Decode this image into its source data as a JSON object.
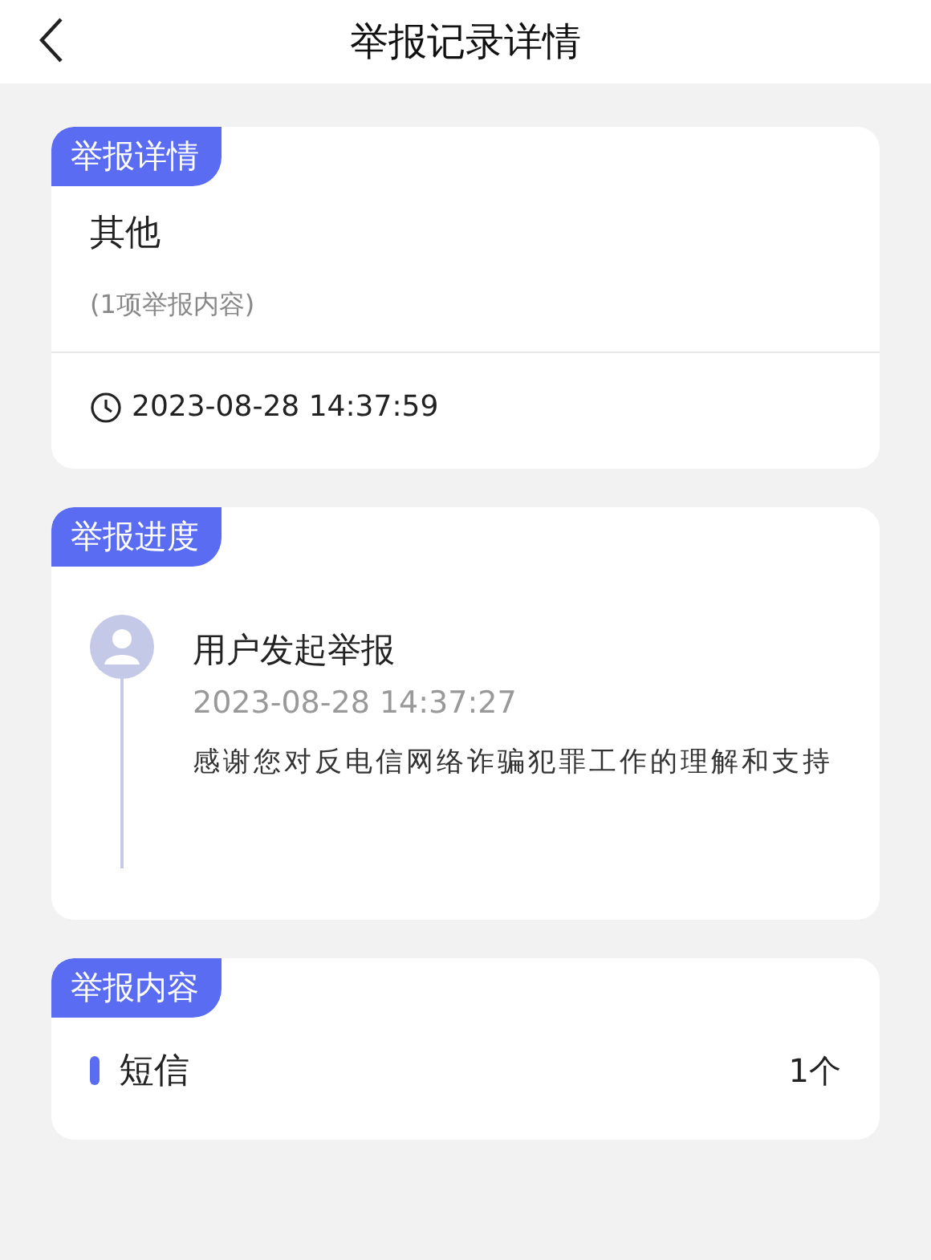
{
  "header": {
    "title": "举报记录详情"
  },
  "details": {
    "badge": "举报详情",
    "category": "其他",
    "count_note": "(1项举报内容)",
    "time": "2023-08-28 14:37:59"
  },
  "progress": {
    "badge": "举报进度",
    "steps": [
      {
        "title": "用户发起举报",
        "time": "2023-08-28 14:37:27",
        "message": "感谢您对反电信网络诈骗犯罪工作的理解和支持"
      }
    ]
  },
  "content": {
    "badge": "举报内容",
    "items": [
      {
        "label": "短信",
        "count": "1个"
      }
    ]
  }
}
